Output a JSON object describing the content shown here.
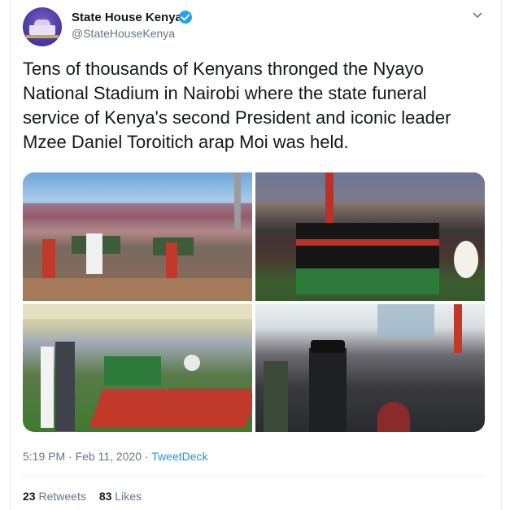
{
  "account": {
    "display_name": "State House Kenya",
    "handle": "@StateHouseKenya",
    "verified": true,
    "avatar_icon": "state-house-building-icon"
  },
  "tweet": {
    "text": "Tens of thousands of Kenyans thronged the Nyayo National Stadium in Nairobi where the state funeral service of Kenya's second President and iconic leader Mzee Daniel Toroitich arap Moi was held.",
    "time": "5:19 PM",
    "separator": " · ",
    "date": "Feb 11, 2020",
    "source_sep": " · ",
    "source": "TweetDeck",
    "photos": [
      "stadium-procession-photo",
      "casket-flag-photo",
      "honour-guard-photo",
      "mourners-photo"
    ]
  },
  "stats": {
    "retweets_count": "23",
    "retweets_label": "Retweets",
    "likes_count": "83",
    "likes_label": "Likes"
  },
  "colors": {
    "text": "#14171a",
    "secondary": "#657786",
    "accent": "#1da1f2",
    "link": "#1b95e0",
    "border": "#e6ecf0"
  },
  "icons": {
    "verified": "verified-badge-icon",
    "menu": "chevron-down-icon"
  }
}
